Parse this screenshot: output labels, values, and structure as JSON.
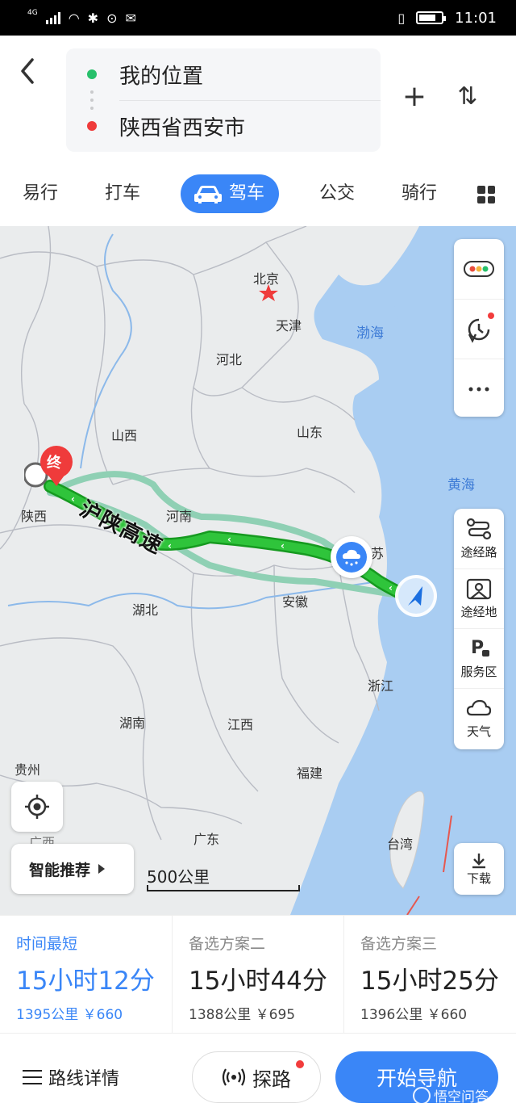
{
  "status_bar": {
    "network": "4G",
    "time": "11:01"
  },
  "header": {
    "origin": "我的位置",
    "destination": "陕西省西安市",
    "add_stop_label": "+",
    "swap_label": "⇅"
  },
  "modes": {
    "items": [
      "易行",
      "打车",
      "驾车",
      "公交",
      "骑行"
    ],
    "active": "驾车"
  },
  "map": {
    "labels": {
      "beijing": "北京",
      "tianjin": "天津",
      "hebei": "河北",
      "shanxi": "山西",
      "shandong": "山东",
      "shaanxi": "陕西",
      "henan": "河南",
      "jiangsu": "苏",
      "anhui": "安徽",
      "hubei": "湖北",
      "zhejiang": "浙江",
      "hunan": "湖南",
      "jiangxi": "江西",
      "guizhou": "贵州",
      "fujian": "福建",
      "guangdong": "广东",
      "guangxi": "广西",
      "taiwan": "台湾",
      "bohai": "渤海",
      "yellow_sea": "黄海"
    },
    "road_name": "沪陕高速",
    "end_marker": "终",
    "scale": "500公里",
    "smart_recommend": "智能推荐",
    "controls": {
      "via_route": "途经路",
      "via_place": "途经地",
      "service_area": "服务区",
      "weather": "天气",
      "download": "下载"
    }
  },
  "options": [
    {
      "name": "时间最短",
      "time": "15小时12分",
      "distance": "1395公里",
      "cost": "￥660",
      "active": true
    },
    {
      "name": "备选方案二",
      "time": "15小时44分",
      "distance": "1388公里",
      "cost": "￥695",
      "active": false
    },
    {
      "name": "备选方案三",
      "time": "15小时25分",
      "distance": "1396公里",
      "cost": "￥660",
      "active": false
    }
  ],
  "bottom": {
    "route_details": "路线详情",
    "explore": "探路",
    "start_navigation": "开始导航",
    "watermark": "悟空问答"
  },
  "colors": {
    "accent": "#3a86f7",
    "route_main": "#22b32a",
    "route_alt": "#8fd0b4",
    "sea": "#a9cdf2",
    "destination_pin": "#ef3b3b"
  }
}
